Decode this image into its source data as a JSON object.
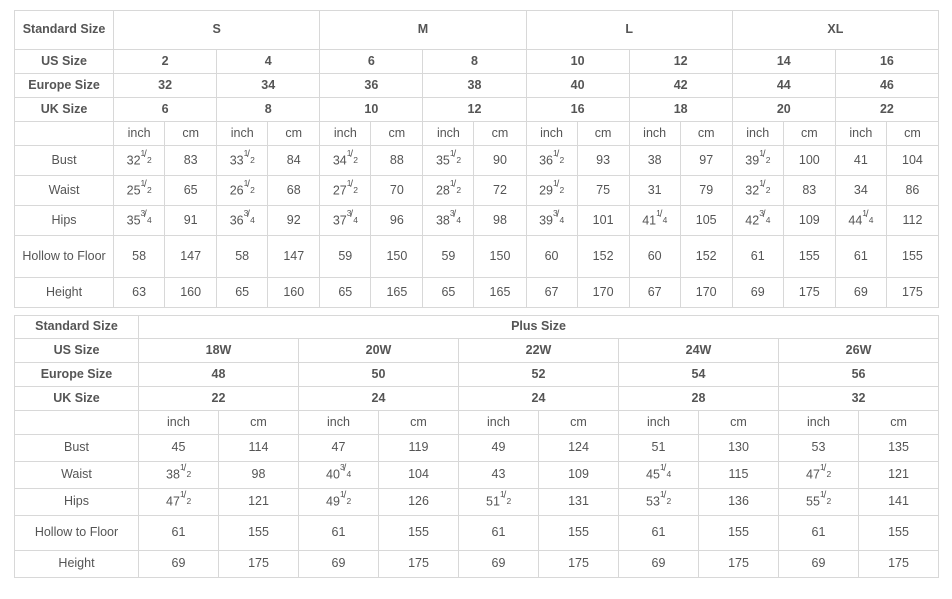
{
  "table1": {
    "name": "standard-size-chart",
    "row_header_label": "Standard Size",
    "us_size_label": "US Size",
    "europe_size_label": "Europe Size",
    "uk_size_label": "UK Size",
    "standard_sizes": [
      "S",
      "M",
      "L",
      "XL"
    ],
    "us_sizes": [
      "2",
      "4",
      "6",
      "8",
      "10",
      "12",
      "14",
      "16"
    ],
    "europe_sizes": [
      "32",
      "34",
      "36",
      "38",
      "40",
      "42",
      "44",
      "46"
    ],
    "uk_sizes": [
      "6",
      "8",
      "10",
      "12",
      "16",
      "18",
      "20",
      "22"
    ],
    "unit_inch": "inch",
    "unit_cm": "cm",
    "measure_labels": [
      "Bust",
      "Waist",
      "Hips",
      "Hollow to Floor",
      "Height"
    ],
    "bust_inch": [
      "32 1/2",
      "33 1/2",
      "34 1/2",
      "35 1/2",
      "36 1/2",
      "38",
      "39 1/2",
      "41"
    ],
    "bust_cm": [
      "83",
      "84",
      "88",
      "90",
      "93",
      "97",
      "100",
      "104"
    ],
    "waist_inch": [
      "25 1/2",
      "26 1/2",
      "27 1/2",
      "28 1/2",
      "29 1/2",
      "31",
      "32 1/2",
      "34"
    ],
    "waist_cm": [
      "65",
      "68",
      "70",
      "72",
      "75",
      "79",
      "83",
      "86"
    ],
    "hips_inch": [
      "35 3/4",
      "36 3/4",
      "37 3/4",
      "38 3/4",
      "39 3/4",
      "41 1/4",
      "42 3/4",
      "44 1/4"
    ],
    "hips_cm": [
      "91",
      "92",
      "96",
      "98",
      "101",
      "105",
      "109",
      "112"
    ],
    "hollow_inch": [
      "58",
      "58",
      "59",
      "59",
      "60",
      "60",
      "61",
      "61"
    ],
    "hollow_cm": [
      "147",
      "147",
      "150",
      "150",
      "152",
      "152",
      "155",
      "155"
    ],
    "height_inch": [
      "63",
      "65",
      "65",
      "65",
      "67",
      "67",
      "69",
      "69"
    ],
    "height_cm": [
      "160",
      "160",
      "165",
      "165",
      "170",
      "170",
      "175",
      "175"
    ]
  },
  "table2": {
    "name": "plus-size-chart",
    "row_header_label": "Standard Size",
    "plus_size_label": "Plus Size",
    "us_size_label": "US Size",
    "europe_size_label": "Europe Size",
    "uk_size_label": "UK Size",
    "us_sizes": [
      "18W",
      "20W",
      "22W",
      "24W",
      "26W"
    ],
    "europe_sizes": [
      "48",
      "50",
      "52",
      "54",
      "56"
    ],
    "uk_sizes": [
      "22",
      "24",
      "24",
      "28",
      "32"
    ],
    "unit_inch": "inch",
    "unit_cm": "cm",
    "measure_labels": [
      "Bust",
      "Waist",
      "Hips",
      "Hollow to Floor",
      "Height"
    ],
    "bust_inch": [
      "45",
      "47",
      "49",
      "51",
      "53"
    ],
    "bust_cm": [
      "114",
      "119",
      "124",
      "130",
      "135"
    ],
    "waist_inch": [
      "38 1/2",
      "40 3/4",
      "43",
      "45 1/4",
      "47 1/2"
    ],
    "waist_cm": [
      "98",
      "104",
      "109",
      "115",
      "121"
    ],
    "hips_inch": [
      "47 1/2",
      "49 1/2",
      "51 1/2",
      "53 1/2",
      "55 1/2"
    ],
    "hips_cm": [
      "121",
      "126",
      "131",
      "136",
      "141"
    ],
    "hollow_inch": [
      "61",
      "61",
      "61",
      "61",
      "61"
    ],
    "hollow_cm": [
      "155",
      "155",
      "155",
      "155",
      "155"
    ],
    "height_inch": [
      "69",
      "69",
      "69",
      "69",
      "69"
    ],
    "height_cm": [
      "175",
      "175",
      "175",
      "175",
      "175"
    ]
  },
  "colors": {
    "header_bg": "#ececec",
    "border": "#d8d8d8",
    "header_text": "#2b2b2b",
    "body_text": "#555555",
    "unit_text": "#8a8a8a",
    "page_bg": "#ffffff"
  }
}
